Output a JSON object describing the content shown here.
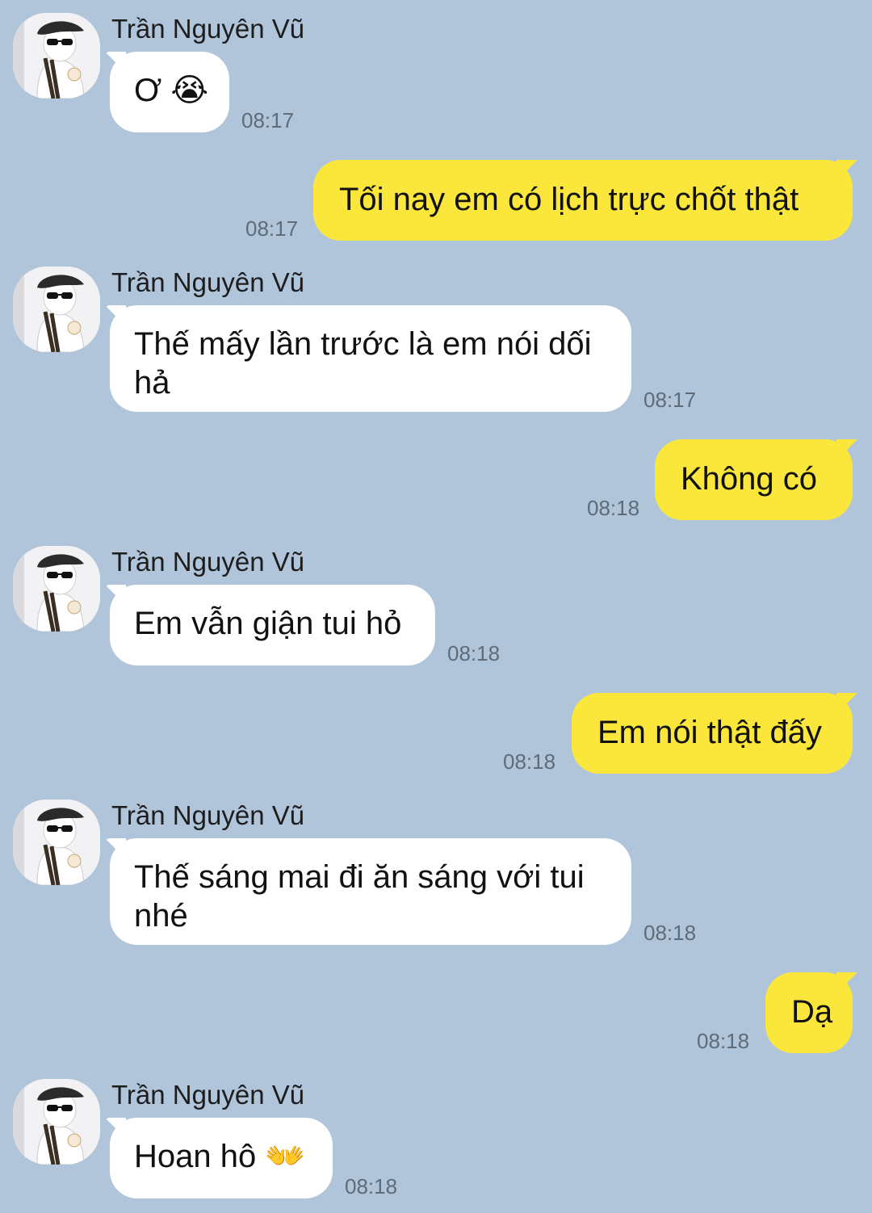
{
  "contact": {
    "name": "Trần Nguyên Vũ"
  },
  "messages": [
    {
      "side": "in",
      "text": "Ơ",
      "emoji": "😭",
      "time": "08:17"
    },
    {
      "side": "out",
      "text": "Tối nay em có lịch trực chốt thật",
      "time": "08:17"
    },
    {
      "side": "in",
      "text": "Thế mấy lần trước là em nói dối hả",
      "time": "08:17"
    },
    {
      "side": "out",
      "text": "Không có",
      "time": "08:18"
    },
    {
      "side": "in",
      "text": "Em vẫn giận tui hỏ",
      "time": "08:18"
    },
    {
      "side": "out",
      "text": "Em nói thật đấy",
      "time": "08:18"
    },
    {
      "side": "in",
      "text": "Thế sáng mai đi ăn sáng với tui nhé",
      "time": "08:18"
    },
    {
      "side": "out",
      "text": "Dạ",
      "time": "08:18"
    },
    {
      "side": "in",
      "text": "Hoan hô",
      "emoji": "👐",
      "time": "08:18"
    }
  ],
  "colors": {
    "background": "#b0c5da",
    "incoming_bubble": "#ffffff",
    "outgoing_bubble": "#fbe73b",
    "timestamp": "#5f6b78"
  }
}
